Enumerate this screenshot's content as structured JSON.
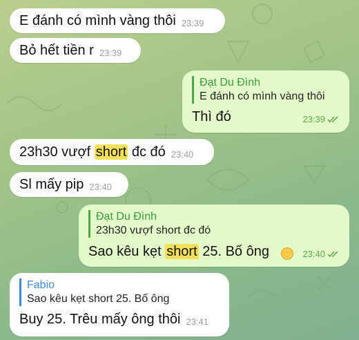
{
  "messages": [
    {
      "text": "E đánh có mình vàng thôi",
      "time": "23:39"
    },
    {
      "text": "Bỏ hết tiền r",
      "time": "23:39"
    },
    {
      "reply_name": "Đạt Du Đình",
      "reply_text": "E đánh có mình vàng thôi",
      "text": "Thì đó",
      "time": "23:39"
    },
    {
      "text_before": "23h30 vượf ",
      "highlight": "short",
      "text_after": " đc đó",
      "time": "23:40"
    },
    {
      "text": "Sl mấy pip",
      "time": "23:40"
    },
    {
      "reply_name": "Đạt Du Đình",
      "reply_text": "23h30 vượf short đc đó",
      "text_before": "Sao kêu kẹt ",
      "highlight": "short",
      "text_after": " 25. Bố ông",
      "emoji": "grinning-face-emoji",
      "time": "23:40"
    },
    {
      "reply_name": "Fabio",
      "reply_text": "Sao kêu kẹt short 25. Bố ông",
      "text": "Buy 25. Trêu mấy ông thôi",
      "time": "23:41"
    }
  ],
  "colors": {
    "incoming": "#ffffff",
    "outgoing": "#e3fbc9",
    "highlight": "#f6e05a",
    "reply_green": "#3a9a3c",
    "reply_blue": "#3d8bd6"
  }
}
